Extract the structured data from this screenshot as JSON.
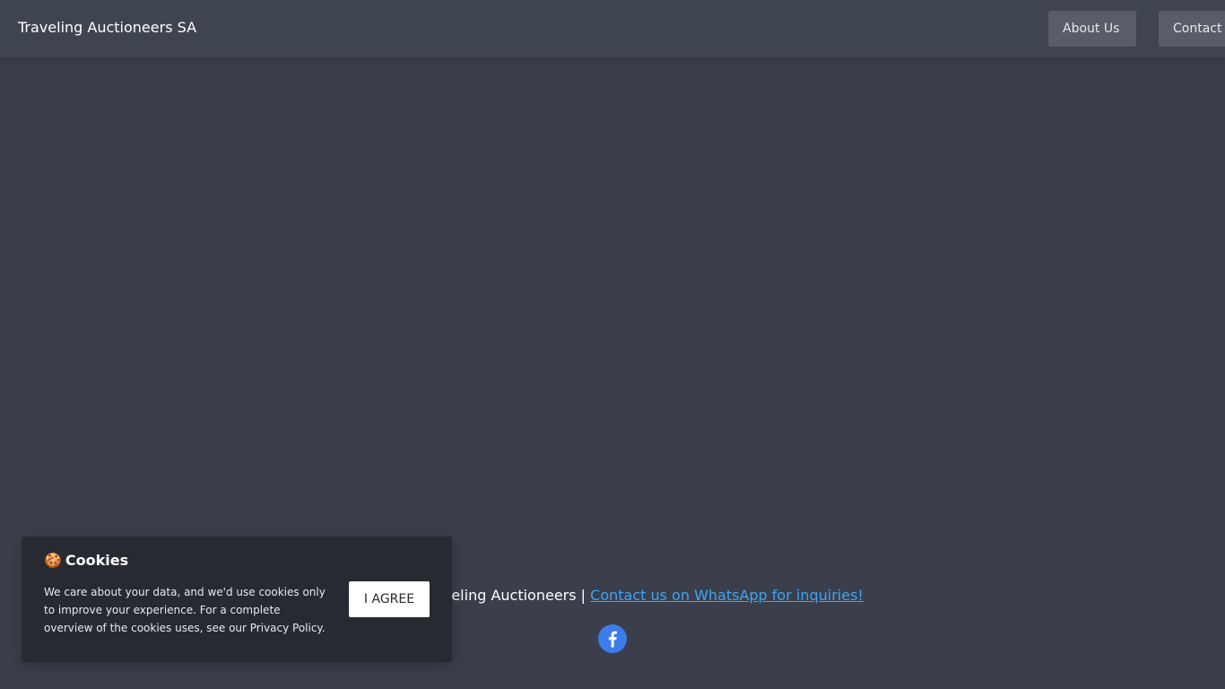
{
  "header": {
    "brand": "Traveling Auctioneers SA",
    "nav": {
      "about_label": "About Us",
      "contact_label": "Contact"
    }
  },
  "footer": {
    "text_prefix": "© 2024 Traveling Auctioneers | ",
    "whatsapp_link": "Contact us on WhatsApp for inquiries!",
    "social_icon": "facebook-icon",
    "social_color": "#3b7de9"
  },
  "cookie_banner": {
    "emoji": "🍪",
    "title": "Cookies",
    "text": "We care about your data, and we'd use cookies only to improve your experience. For a complete overview of the cookies uses, see our Privacy Policy.",
    "agree_label": "I AGREE"
  },
  "colors": {
    "background": "#3a3f4b",
    "header": "#3f4451",
    "nav_button": "#585d69",
    "cookie_banner": "#272a31",
    "link": "#3ea4f5"
  }
}
